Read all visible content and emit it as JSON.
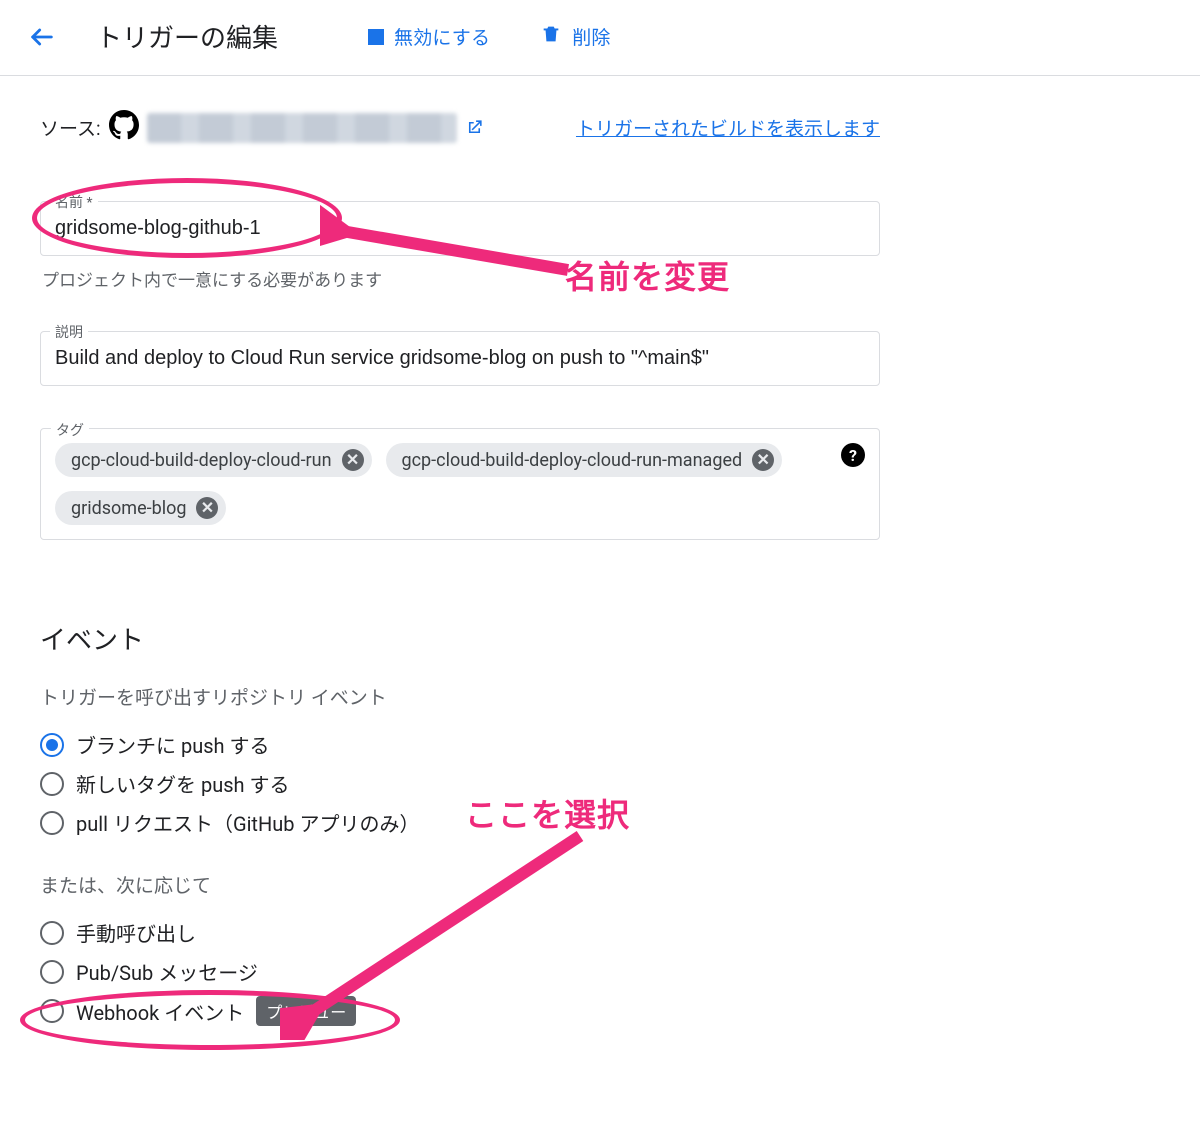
{
  "header": {
    "title": "トリガーの編集",
    "disable_label": "無効にする",
    "delete_label": "削除"
  },
  "source": {
    "label": "ソース:",
    "view_builds_link": "トリガーされたビルドを表示します"
  },
  "name_field": {
    "label": "名前 *",
    "value": "gridsome-blog-github-1",
    "helper": "プロジェクト内で一意にする必要があります"
  },
  "desc_field": {
    "label": "説明",
    "value": "Build and deploy to Cloud Run service gridsome-blog on push to \"^main$\""
  },
  "tags_field": {
    "label": "タグ",
    "tags": [
      "gcp-cloud-build-deploy-cloud-run",
      "gcp-cloud-build-deploy-cloud-run-managed",
      "gridsome-blog"
    ]
  },
  "events": {
    "title": "イベント",
    "subhead_repo": "トリガーを呼び出すリポジトリ イベント",
    "repo_options": [
      {
        "label": "ブランチに push する",
        "selected": true
      },
      {
        "label": "新しいタグを push する",
        "selected": false
      },
      {
        "label": "pull リクエスト（GitHub アプリのみ）",
        "selected": false
      }
    ],
    "subhead_or": "または、次に応じて",
    "or_options": [
      {
        "label": "手動呼び出し"
      },
      {
        "label": "Pub/Sub メッセージ"
      },
      {
        "label": "Webhook イベント",
        "badge": "プレビュー"
      }
    ]
  },
  "annotations": {
    "name_note": "名前を変更",
    "select_note": "ここを選択"
  }
}
